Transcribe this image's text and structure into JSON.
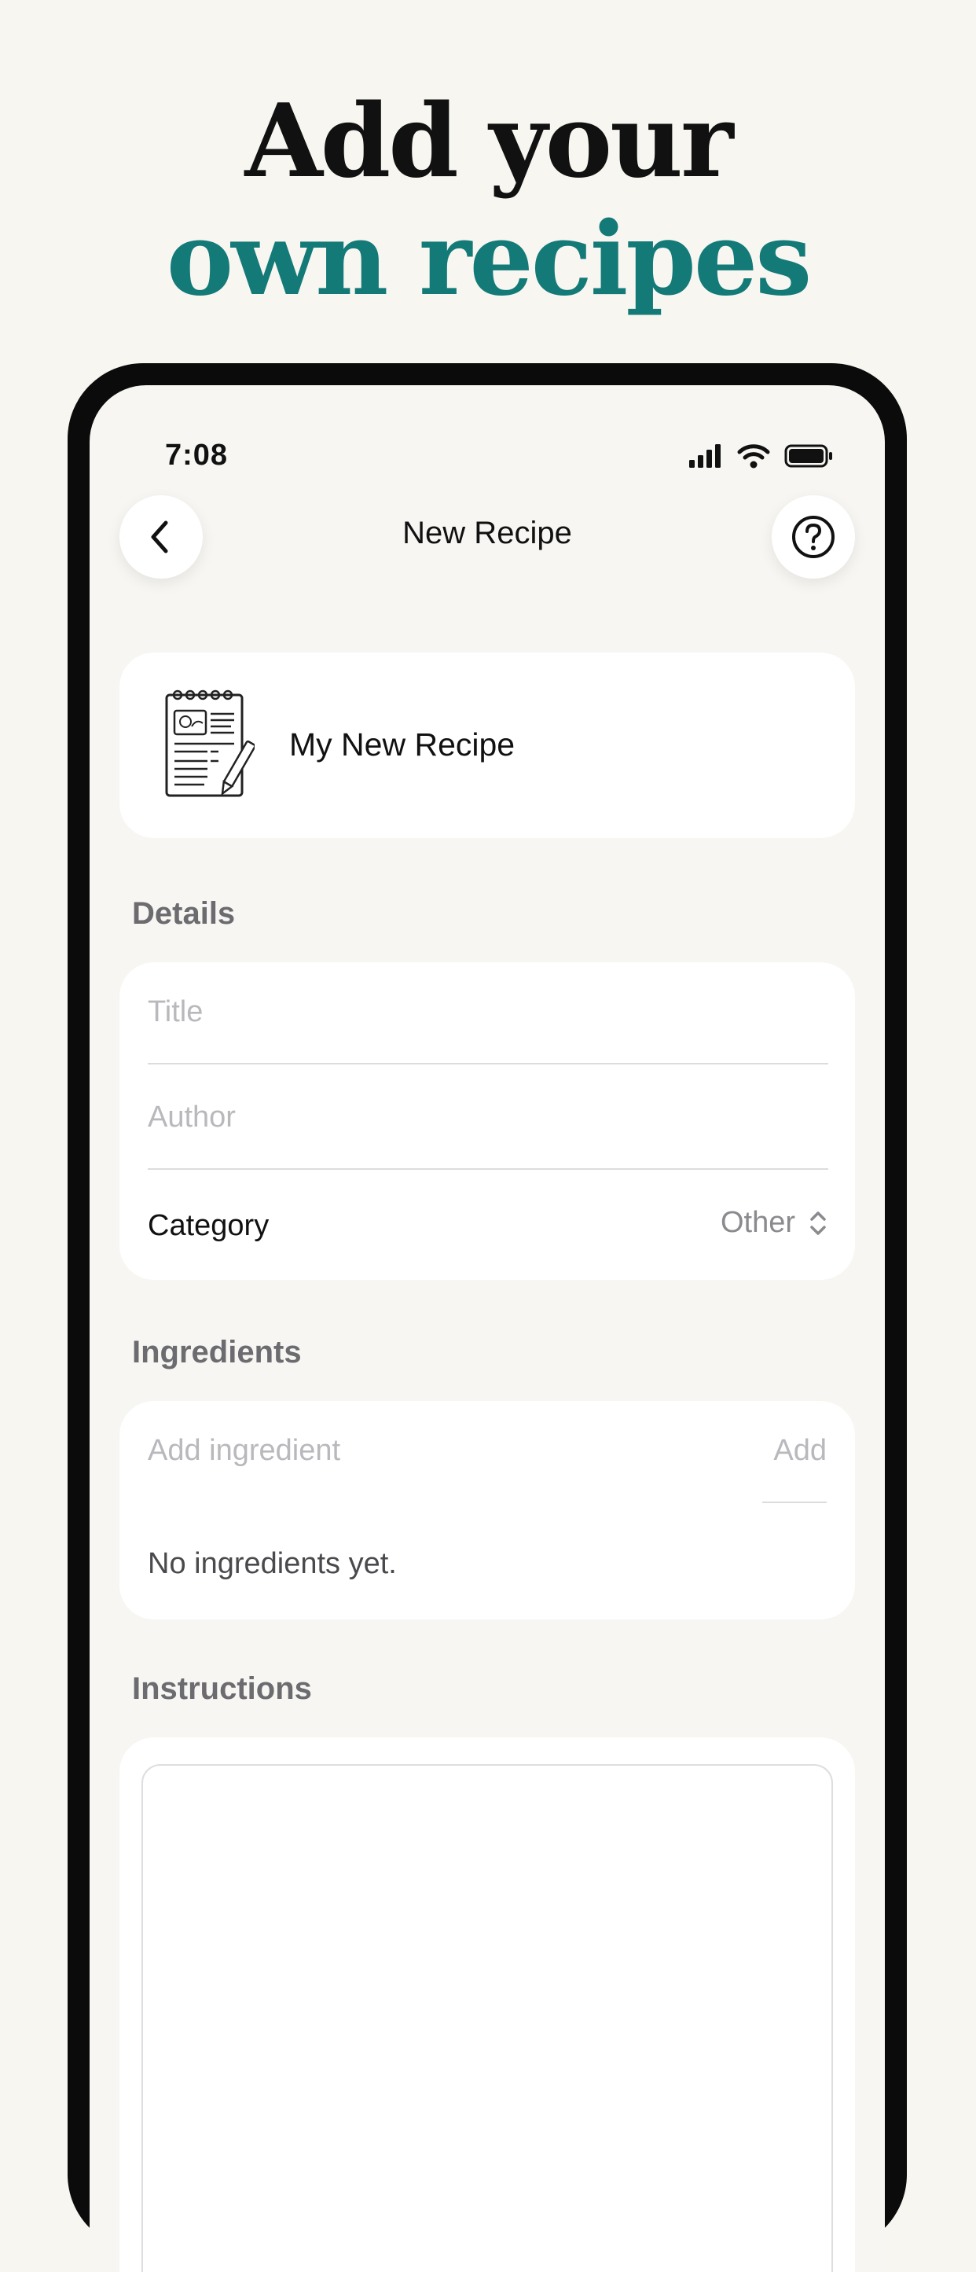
{
  "headline": {
    "line1": "Add your",
    "line2": "own recipes"
  },
  "status_bar": {
    "time": "7:08"
  },
  "nav": {
    "title": "New Recipe",
    "back_icon": "chevron-left-icon",
    "help_icon": "question-circle-icon"
  },
  "recipe": {
    "name": "My New Recipe",
    "thumbnail_icon": "recipe-notebook-icon"
  },
  "details": {
    "label": "Details",
    "title_placeholder": "Title",
    "author_placeholder": "Author",
    "category_label": "Category",
    "category_value": "Other"
  },
  "ingredients": {
    "label": "Ingredients",
    "input_placeholder": "Add ingredient",
    "add_label": "Add",
    "empty_text": "No ingredients yet."
  },
  "instructions": {
    "label": "Instructions"
  },
  "colors": {
    "accent": "#137a78",
    "background": "#f7f6f1",
    "card": "#ffffff"
  }
}
